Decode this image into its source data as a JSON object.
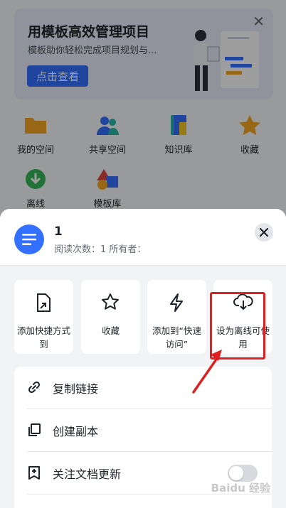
{
  "banner": {
    "title": "用模板高效管理项目",
    "subtitle": "模板助你轻松完成项目规划与...",
    "button_label": "点击查看",
    "close_glyph": "✕"
  },
  "grid": [
    {
      "label": "我的空间",
      "icon": "folder-icon"
    },
    {
      "label": "共享空间",
      "icon": "people-icon"
    },
    {
      "label": "知识库",
      "icon": "book-icon"
    },
    {
      "label": "收藏",
      "icon": "star-icon"
    },
    {
      "label": "离线",
      "icon": "offline-download-icon"
    },
    {
      "label": "模板库",
      "icon": "template-shapes-icon"
    }
  ],
  "sheet": {
    "doc_title": "1",
    "doc_meta": "阅读次数：1  所有者：",
    "actions": [
      {
        "label": "添加快捷方式到",
        "icon": "shortcut-icon"
      },
      {
        "label": "收藏",
        "icon": "star-icon"
      },
      {
        "label": "添加到“快速访问”",
        "icon": "lightning-icon"
      },
      {
        "label": "设为离线可使用",
        "icon": "cloud-download-icon"
      }
    ],
    "list": [
      {
        "label": "复制链接",
        "icon": "link-icon"
      },
      {
        "label": "创建副本",
        "icon": "copy-icon"
      },
      {
        "label": "关注文档更新",
        "icon": "follow-icon"
      }
    ]
  },
  "watermark": "Baidu 经验",
  "colors": {
    "accent": "#3370ff",
    "highlight": "#e02020"
  }
}
